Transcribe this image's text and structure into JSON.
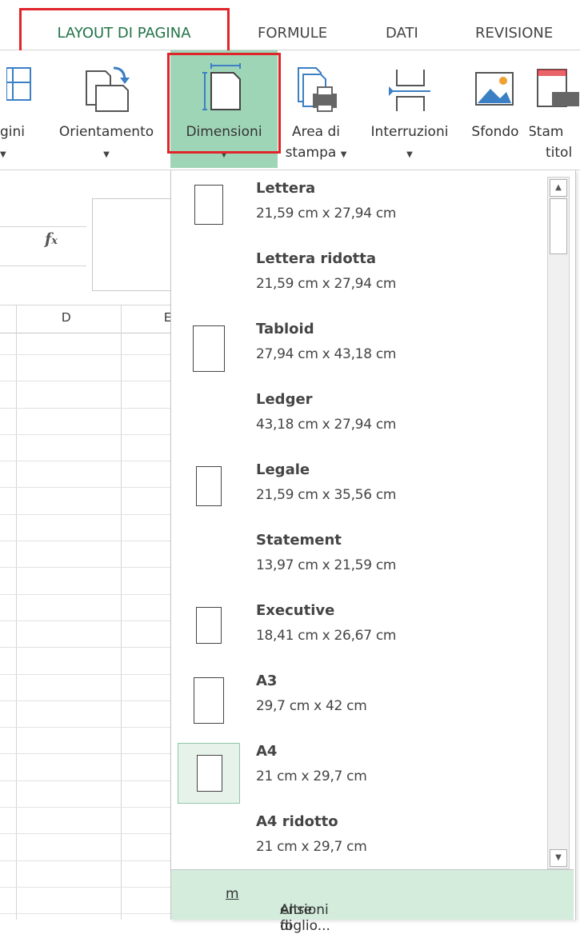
{
  "tabs": [
    {
      "label": "LAYOUT DI PAGINA",
      "active": true
    },
    {
      "label": "FORMULE"
    },
    {
      "label": "DATI"
    },
    {
      "label": "REVISIONE"
    }
  ],
  "ribbon": {
    "pagini": "gini",
    "orientamento": "Orientamento",
    "dimensioni": "Dimensioni",
    "area_di": "Area di",
    "stampa": "stampa",
    "interruzioni": "Interruzioni",
    "sfondo": "Sfondo",
    "stam": "Stam",
    "titol": "titol",
    "caret": "▼"
  },
  "formula_bar": {
    "fx": "fx"
  },
  "columns": {
    "d": "D",
    "e": "E"
  },
  "paper_sizes": [
    {
      "name": "Lettera",
      "size": "21,59 cm x 27,94 cm",
      "selected": false
    },
    {
      "name": "Lettera ridotta",
      "size": "21,59 cm x 27,94 cm",
      "selected": false
    },
    {
      "name": "Tabloid",
      "size": "27,94 cm x 43,18 cm",
      "selected": false
    },
    {
      "name": "Ledger",
      "size": "43,18 cm x 27,94 cm",
      "selected": false
    },
    {
      "name": "Legale",
      "size": "21,59 cm x 35,56 cm",
      "selected": false
    },
    {
      "name": "Statement",
      "size": "13,97 cm x 21,59 cm",
      "selected": false
    },
    {
      "name": "Executive",
      "size": "18,41 cm x 26,67 cm",
      "selected": false
    },
    {
      "name": "A3",
      "size": "29,7 cm x 42 cm",
      "selected": false
    },
    {
      "name": "A4",
      "size": "21 cm x 29,7 cm",
      "selected": true
    },
    {
      "name": "A4 ridotto",
      "size": "21 cm x 29,7 cm",
      "selected": false
    }
  ],
  "more_sizes": {
    "before": "Altre di",
    "underline": "m",
    "after": "ensioni foglio..."
  },
  "colors": {
    "accent": "#217346",
    "highlight": "#e0242a",
    "selected_fill": "#9fd5b7"
  }
}
